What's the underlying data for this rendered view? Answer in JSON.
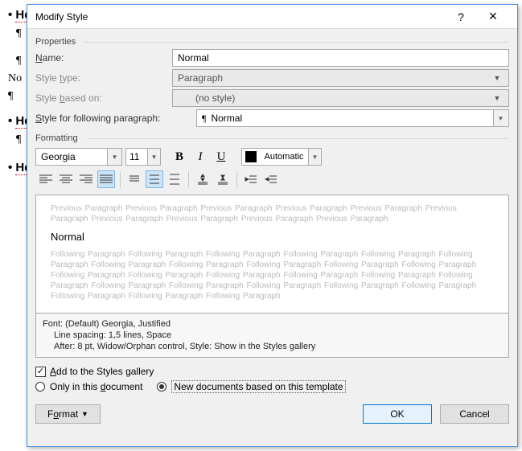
{
  "bg": {
    "h1": "He",
    "pilcrow": "¶",
    "no": "No",
    "h2": "He",
    "h3": "He"
  },
  "dialog": {
    "title": "Modify Style",
    "help": "?",
    "close": "×"
  },
  "properties": {
    "group": "Properties",
    "name_label_pre": "",
    "name_label_u": "N",
    "name_label_post": "ame:",
    "name_value": "Normal",
    "type_label_pre": "Style ",
    "type_label_u": "t",
    "type_label_post": "ype:",
    "type_value": "Paragraph",
    "based_label_pre": "Style ",
    "based_label_u": "b",
    "based_label_post": "ased on:",
    "based_value": "(no style)",
    "follow_label_pre": "",
    "follow_label_u": "S",
    "follow_label_post": "tyle for following paragraph:",
    "follow_value": "Normal"
  },
  "formatting": {
    "group": "Formatting",
    "font": "Georgia",
    "size": "11",
    "bold": "B",
    "italic": "I",
    "underline": "U",
    "color": "Automatic"
  },
  "preview": {
    "prev_text": "Previous Paragraph Previous Paragraph Previous Paragraph Previous Paragraph Previous Paragraph Previous Paragraph Previous Paragraph Previous Paragraph Previous Paragraph Previous Paragraph",
    "sample": "Normal",
    "next_text": "Following Paragraph Following Paragraph Following Paragraph Following Paragraph Following Paragraph Following Paragraph Following Paragraph Following Paragraph Following Paragraph Following Paragraph Following Paragraph Following Paragraph Following Paragraph Following Paragraph Following Paragraph Following Paragraph Following Paragraph Following Paragraph Following Paragraph Following Paragraph Following Paragraph Following Paragraph Following Paragraph Following Paragraph Following Paragraph"
  },
  "summary": {
    "line1": "Font: (Default) Georgia, Justified",
    "line2": "Line spacing:  1,5 lines, Space",
    "line3": "After:  8 pt, Widow/Orphan control, Style: Show in the Styles gallery"
  },
  "options": {
    "add_gallery_pre": "",
    "add_gallery_u": "A",
    "add_gallery_post": "dd to the Styles gallery",
    "only_doc": "Only in this ",
    "only_doc_u": "d",
    "only_doc_post": "ocument",
    "new_docs": "New documents based on this template"
  },
  "buttons": {
    "format_pre": "F",
    "format_u": "o",
    "format_post": "rmat",
    "ok": "OK",
    "cancel": "Cancel"
  }
}
